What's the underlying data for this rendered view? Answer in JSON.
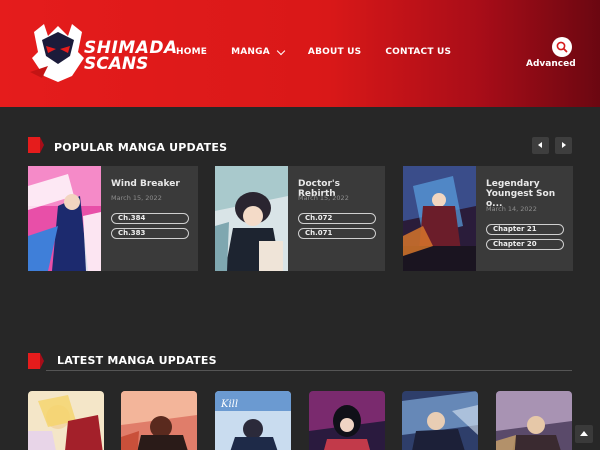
{
  "header": {
    "logo_line1": "SHIMADA",
    "logo_line2": "SCANS",
    "nav": [
      {
        "label": "HOME"
      },
      {
        "label": "MANGA",
        "has_dropdown": true
      },
      {
        "label": "ABOUT US"
      },
      {
        "label": "CONTACT US"
      }
    ],
    "advanced_label": "Advanced",
    "search_icon": "search-icon"
  },
  "popular": {
    "title": "POPULAR MANGA UPDATES",
    "items": [
      {
        "title": "Wind Breaker",
        "date": "March 15, 2022",
        "chapters": [
          "Ch.384",
          "Ch.383"
        ]
      },
      {
        "title": "Doctor's Rebirth",
        "date": "March 15, 2022",
        "chapters": [
          "Ch.072",
          "Ch.071"
        ]
      },
      {
        "title": "Legendary Youngest Son o...",
        "date": "March 14, 2022",
        "chapters": [
          "Chapter 21",
          "Chapter 20"
        ]
      }
    ]
  },
  "latest": {
    "title": "LATEST MANGA UPDATES"
  },
  "colors": {
    "header_red": "#e51c1c",
    "header_dark": "#6b0711",
    "background": "#272727",
    "card": "#3a3a3a"
  }
}
